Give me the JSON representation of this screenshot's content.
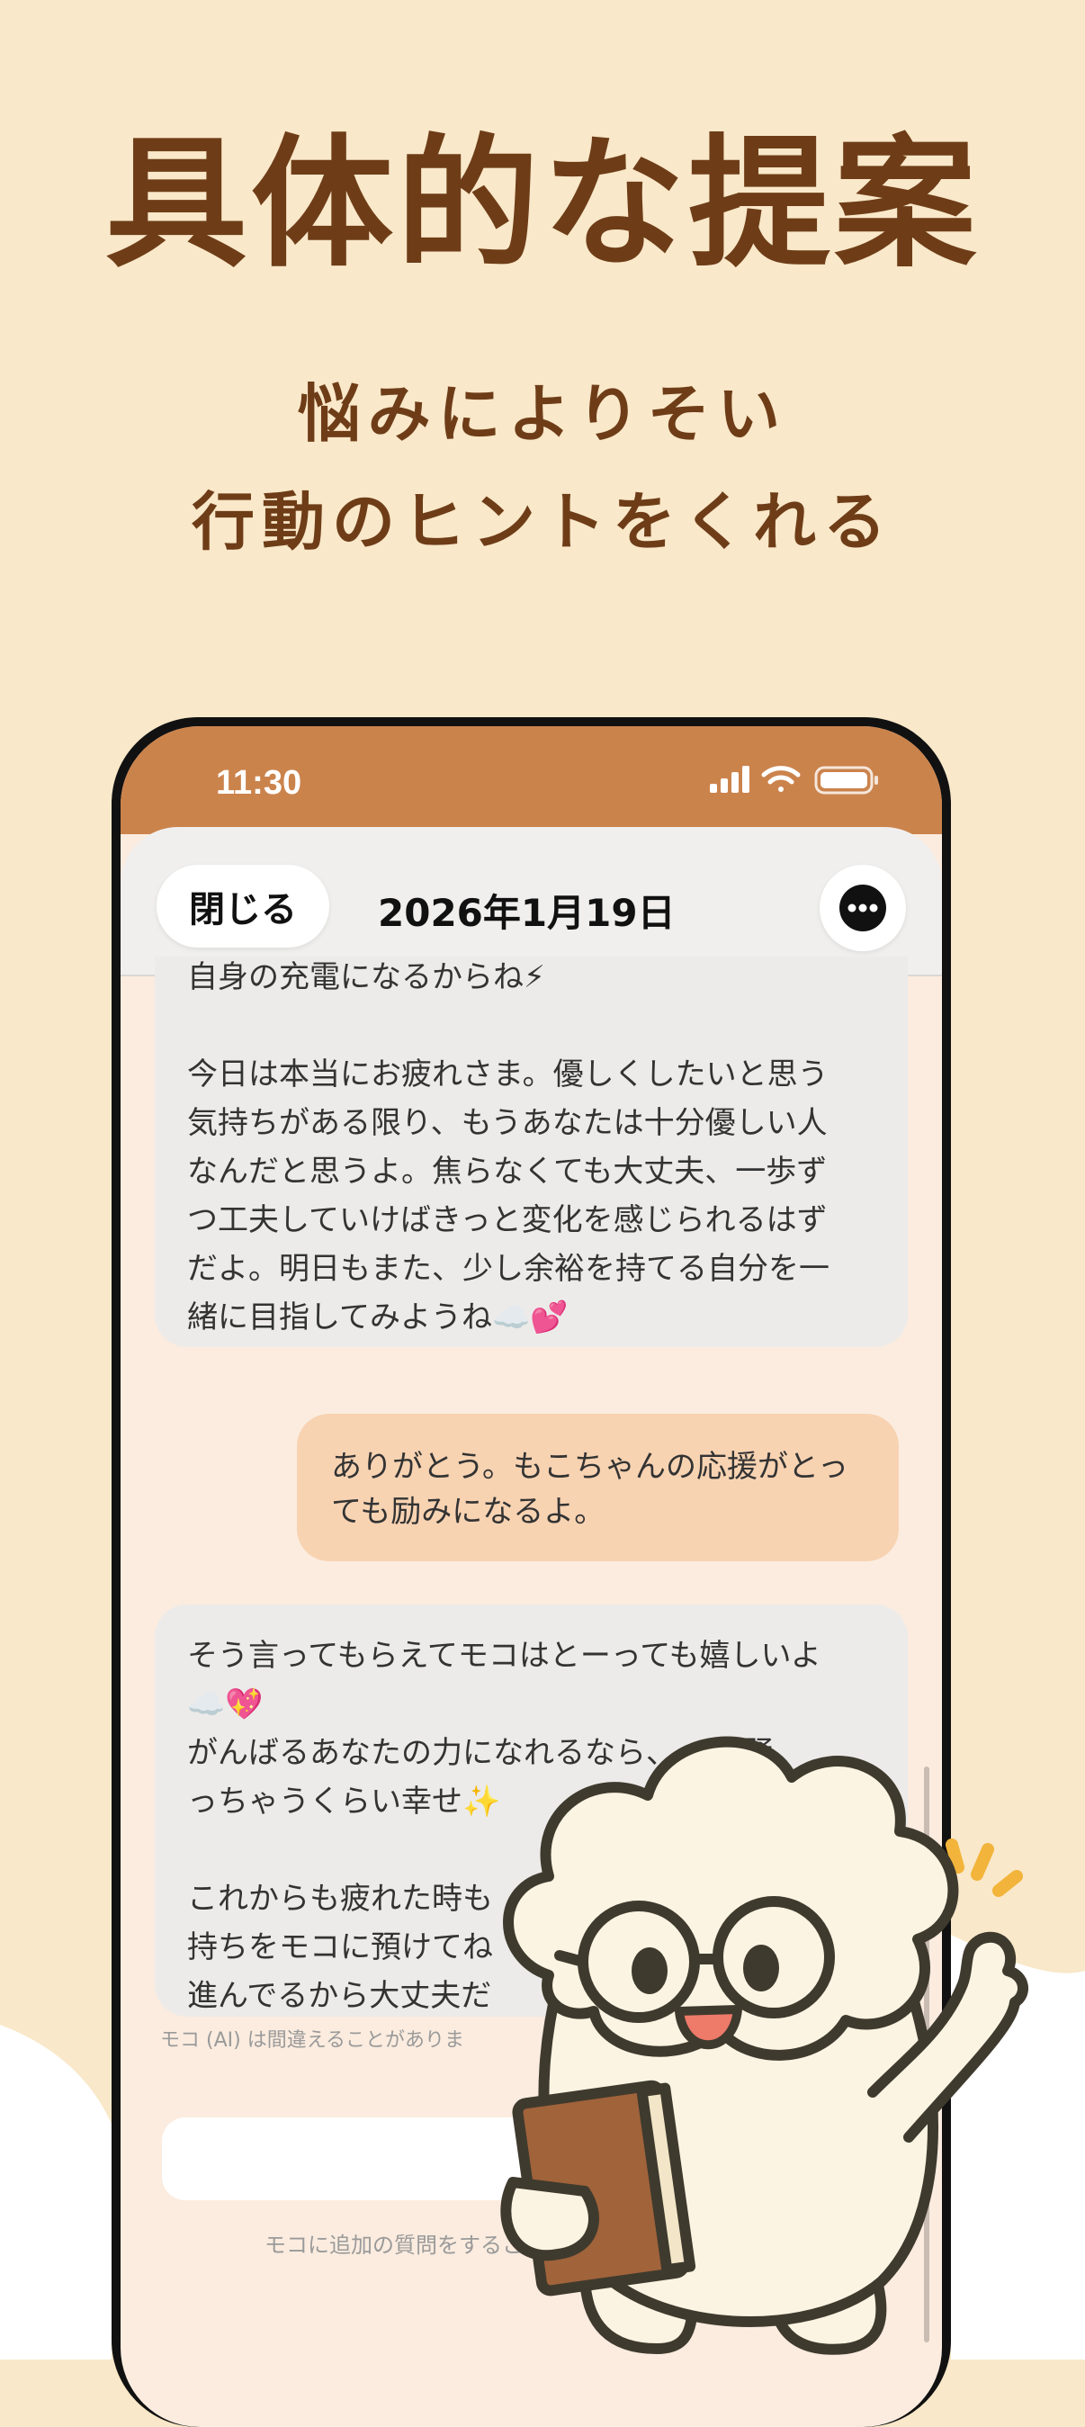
{
  "headline": "具体的な提案",
  "subline1": "悩みによりそい",
  "subline2": "行動のヒントをくれる",
  "status_bar": {
    "time": "11:30"
  },
  "header": {
    "close_label": "閉じる",
    "date": "2026年1月19日"
  },
  "messages": {
    "ai_1": [
      "自身の充電になるからね⚡",
      "",
      "今日は本当にお疲れさま。優しくしたいと思う",
      "気持ちがある限り、もうあなたは十分優しい人",
      "なんだと思うよ。焦らなくても大丈夫、一歩ず",
      "つ工夫していけばきっと変化を感じられるはず",
      "だよ。明日もまた、少し余裕を持てる自分を一",
      "緒に目指してみようね☁️💕"
    ],
    "user_1": [
      "ありがとう。もこちゃんの応援がとっ",
      "ても励みになるよ。"
    ],
    "ai_2": [
      "そう言ってもらえてモコはとーっても嬉しいよ",
      "☁️💖",
      "がんばるあなたの力になれるなら、",
      "で踊",
      "っちゃうくらい幸せ✨",
      "",
      "これからも疲れた時も",
      "持ちをモコに預けてね",
      "進んでるから大丈夫だ"
    ]
  },
  "disclaimer": "モコ (AI) は間違えることがありま",
  "input_hint": "モコに追加の質問をすること",
  "colors": {
    "background": "#f9e8c9",
    "headline": "#6e3d18",
    "status_bar": "#cb834c",
    "user_bubble": "#f8d3b2",
    "ai_bubble": "#ecebe9"
  }
}
